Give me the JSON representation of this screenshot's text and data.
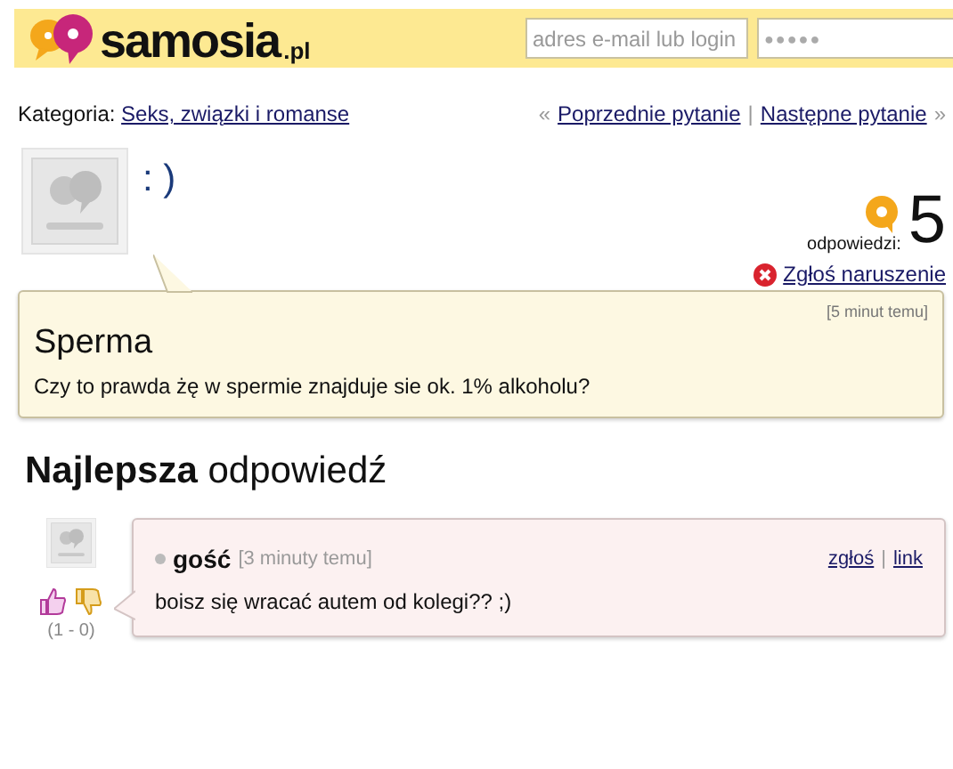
{
  "header": {
    "logo": {
      "name": "samosia",
      "suffix": ".pl"
    },
    "login_field": {
      "placeholder": "adres e-mail lub login"
    },
    "password_field": {
      "value": "●●●●●"
    }
  },
  "nav": {
    "category_label": "Kategoria:",
    "category": "Seks, związki i romanse",
    "prev_mark": "«",
    "prev": "Poprzednie pytanie",
    "separator": "|",
    "next": "Następne pytanie",
    "next_mark": "»"
  },
  "question": {
    "author": ": )",
    "answers_label": "odpowiedzi:",
    "answers_count": "5",
    "report": "Zgłoś naruszenie",
    "time": "[5 minut temu]",
    "title": "Sperma",
    "body": "Czy to prawda żę w spermie znajduje sie ok. 1% alkoholu?"
  },
  "best_answer": {
    "heading_bold": "Najlepsza",
    "heading_rest": "odpowiedź",
    "votes": "(1 - 0)",
    "author": "gość",
    "time": "[3 minuty temu]",
    "report": "zgłoś",
    "separator": "|",
    "link": "link",
    "body": "boisz się wracać autem od kolegi?? ;)"
  }
}
